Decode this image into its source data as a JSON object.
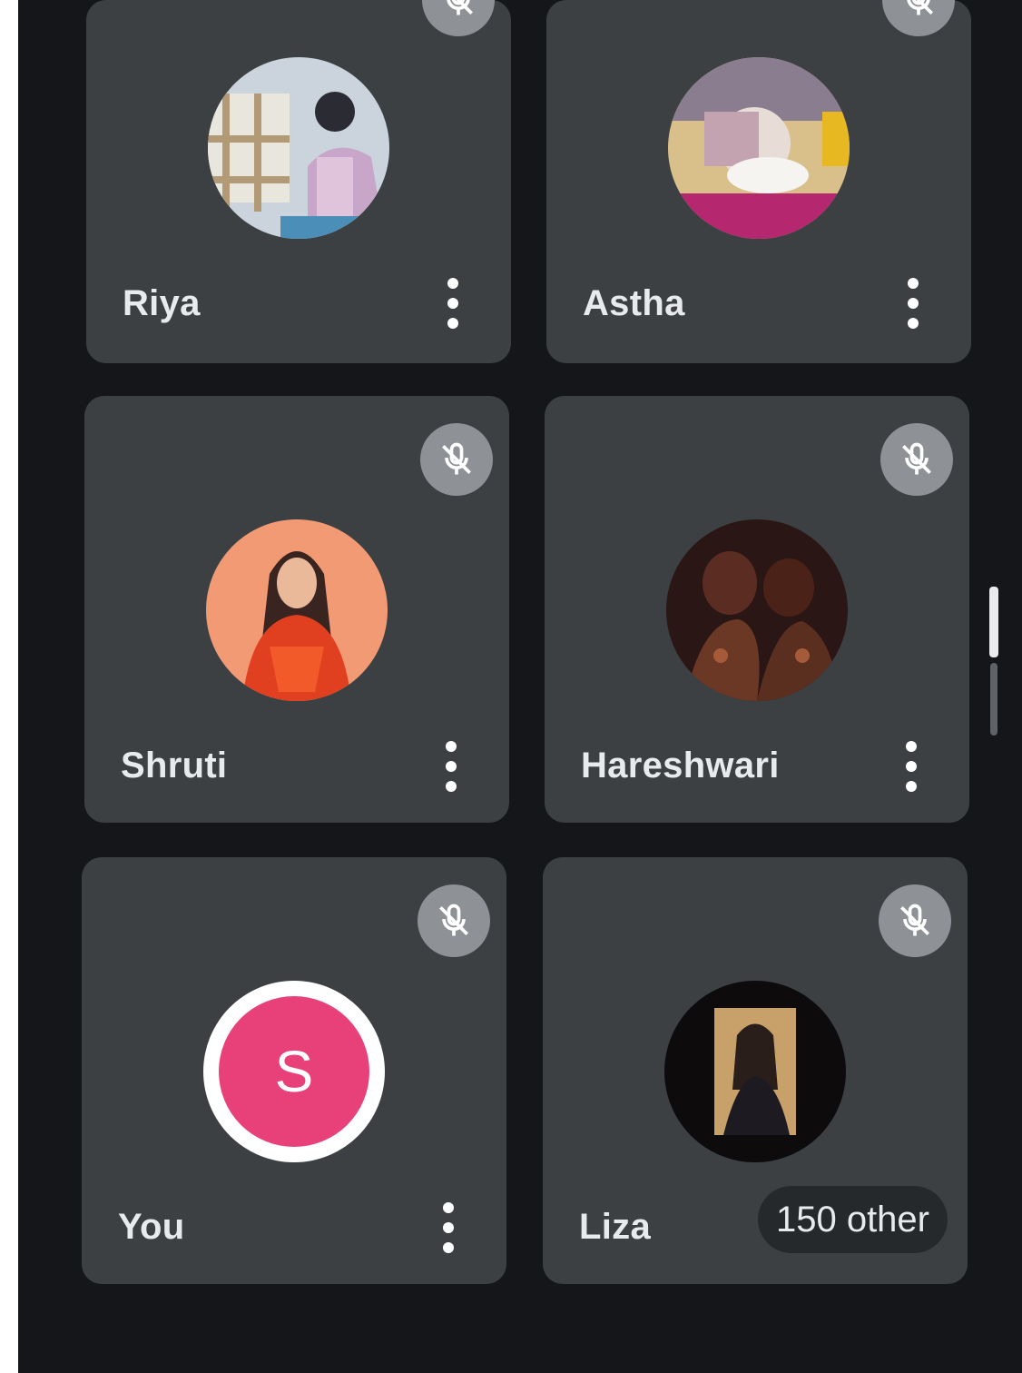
{
  "participants": [
    {
      "name": "Riya"
    },
    {
      "name": "Astha"
    },
    {
      "name": "Shruti"
    },
    {
      "name": "Hareshwari"
    },
    {
      "name": "You",
      "initial": "S"
    },
    {
      "name": "Liza"
    }
  ],
  "overflow": {
    "label": "150 other"
  },
  "colors": {
    "background": "#141619",
    "tile": "#3c4043",
    "muted_badge": "#8e9195",
    "self_avatar": "#e8417a"
  },
  "icons": {
    "mute": "mic-off-icon",
    "menu": "more-vert-icon"
  }
}
